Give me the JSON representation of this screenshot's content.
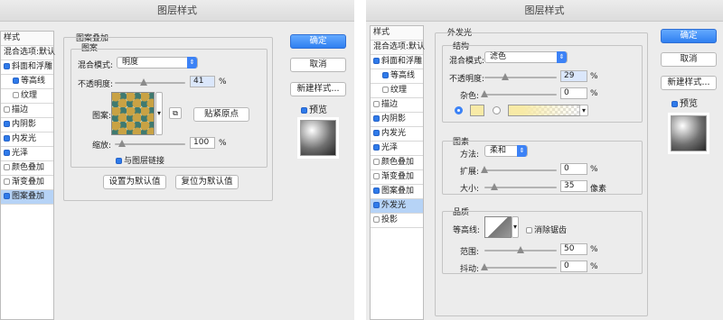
{
  "left": {
    "window_title": "图层样式",
    "sidebar": {
      "items": [
        {
          "label": "样式",
          "checked": null,
          "active": false,
          "sub": false,
          "hdr": true
        },
        {
          "label": "混合选项:默认",
          "checked": null,
          "active": false,
          "sub": false,
          "hdr": true
        },
        {
          "label": "斜面和浮雕",
          "checked": true,
          "active": false,
          "sub": false,
          "hdr": false
        },
        {
          "label": "等高线",
          "checked": true,
          "active": false,
          "sub": true,
          "hdr": false
        },
        {
          "label": "纹理",
          "checked": false,
          "active": false,
          "sub": true,
          "hdr": false
        },
        {
          "label": "描边",
          "checked": false,
          "active": false,
          "sub": false,
          "hdr": false
        },
        {
          "label": "内阴影",
          "checked": true,
          "active": false,
          "sub": false,
          "hdr": false
        },
        {
          "label": "内发光",
          "checked": true,
          "active": false,
          "sub": false,
          "hdr": false
        },
        {
          "label": "光泽",
          "checked": true,
          "active": false,
          "sub": false,
          "hdr": false
        },
        {
          "label": "颜色叠加",
          "checked": false,
          "active": false,
          "sub": false,
          "hdr": false
        },
        {
          "label": "渐变叠加",
          "checked": false,
          "active": false,
          "sub": false,
          "hdr": false
        },
        {
          "label": "图案叠加",
          "checked": true,
          "active": true,
          "sub": false,
          "hdr": false
        }
      ]
    },
    "section_title": "图案叠加",
    "group_title": "图案",
    "blend_mode_label": "混合模式:",
    "blend_mode_value": "明度",
    "opacity_label": "不透明度:",
    "opacity_value": "41",
    "opacity_level": 0.41,
    "unit_percent": "%",
    "pattern_label": "图案:",
    "snap_button": "贴紧原点",
    "scale_label": "缩放:",
    "scale_value": "100",
    "scale_level": 0.1,
    "link_checkbox": "与图层链接",
    "link_checked": true,
    "reset_default_button": "设置为默认值",
    "restore_default_button": "复位为默认值",
    "ok_button": "确定",
    "cancel_button": "取消",
    "new_style_button": "新建样式...",
    "preview_label": "预览",
    "preview_checked": true
  },
  "right": {
    "window_title": "图层样式",
    "sidebar": {
      "items": [
        {
          "label": "样式",
          "checked": null,
          "active": false,
          "sub": false,
          "hdr": true
        },
        {
          "label": "混合选项:默认",
          "checked": null,
          "active": false,
          "sub": false,
          "hdr": true
        },
        {
          "label": "斜面和浮雕",
          "checked": true,
          "active": false,
          "sub": false,
          "hdr": false
        },
        {
          "label": "等高线",
          "checked": true,
          "active": false,
          "sub": true,
          "hdr": false
        },
        {
          "label": "纹理",
          "checked": false,
          "active": false,
          "sub": true,
          "hdr": false
        },
        {
          "label": "描边",
          "checked": false,
          "active": false,
          "sub": false,
          "hdr": false
        },
        {
          "label": "内阴影",
          "checked": true,
          "active": false,
          "sub": false,
          "hdr": false
        },
        {
          "label": "内发光",
          "checked": true,
          "active": false,
          "sub": false,
          "hdr": false
        },
        {
          "label": "光泽",
          "checked": true,
          "active": false,
          "sub": false,
          "hdr": false
        },
        {
          "label": "颜色叠加",
          "checked": false,
          "active": false,
          "sub": false,
          "hdr": false
        },
        {
          "label": "渐变叠加",
          "checked": false,
          "active": false,
          "sub": false,
          "hdr": false
        },
        {
          "label": "图案叠加",
          "checked": true,
          "active": false,
          "sub": false,
          "hdr": false
        },
        {
          "label": "外发光",
          "checked": true,
          "active": true,
          "sub": false,
          "hdr": false
        },
        {
          "label": "投影",
          "checked": false,
          "active": false,
          "sub": false,
          "hdr": false
        }
      ]
    },
    "section_title": "外发光",
    "structure_title": "结构",
    "blend_mode_label": "混合模式:",
    "blend_mode_value": "滤色",
    "opacity_label": "不透明度:",
    "opacity_value": "29",
    "opacity_level": 0.29,
    "noise_label": "杂色:",
    "noise_value": "0",
    "noise_level": 0,
    "unit_percent": "%",
    "glow_color": "#f8eaa6",
    "elements_title": "图素",
    "method_label": "方法:",
    "method_value": "柔和",
    "spread_label": "扩展:",
    "spread_value": "0",
    "spread_level": 0,
    "size_label": "大小:",
    "size_value": "35",
    "size_level": 0.14,
    "size_unit": "像素",
    "quality_title": "品质",
    "contour_label": "等高线:",
    "antialias_label": "消除锯齿",
    "antialias_checked": false,
    "range_label": "范围:",
    "range_value": "50",
    "range_level": 0.5,
    "jitter_label": "抖动:",
    "jitter_value": "0",
    "jitter_level": 0,
    "ok_button": "确定",
    "cancel_button": "取消",
    "new_style_button": "新建样式...",
    "preview_label": "预览",
    "preview_checked": true
  },
  "colors": {
    "accent": "#2f7ff0",
    "active_row": "#b6d3f6"
  }
}
